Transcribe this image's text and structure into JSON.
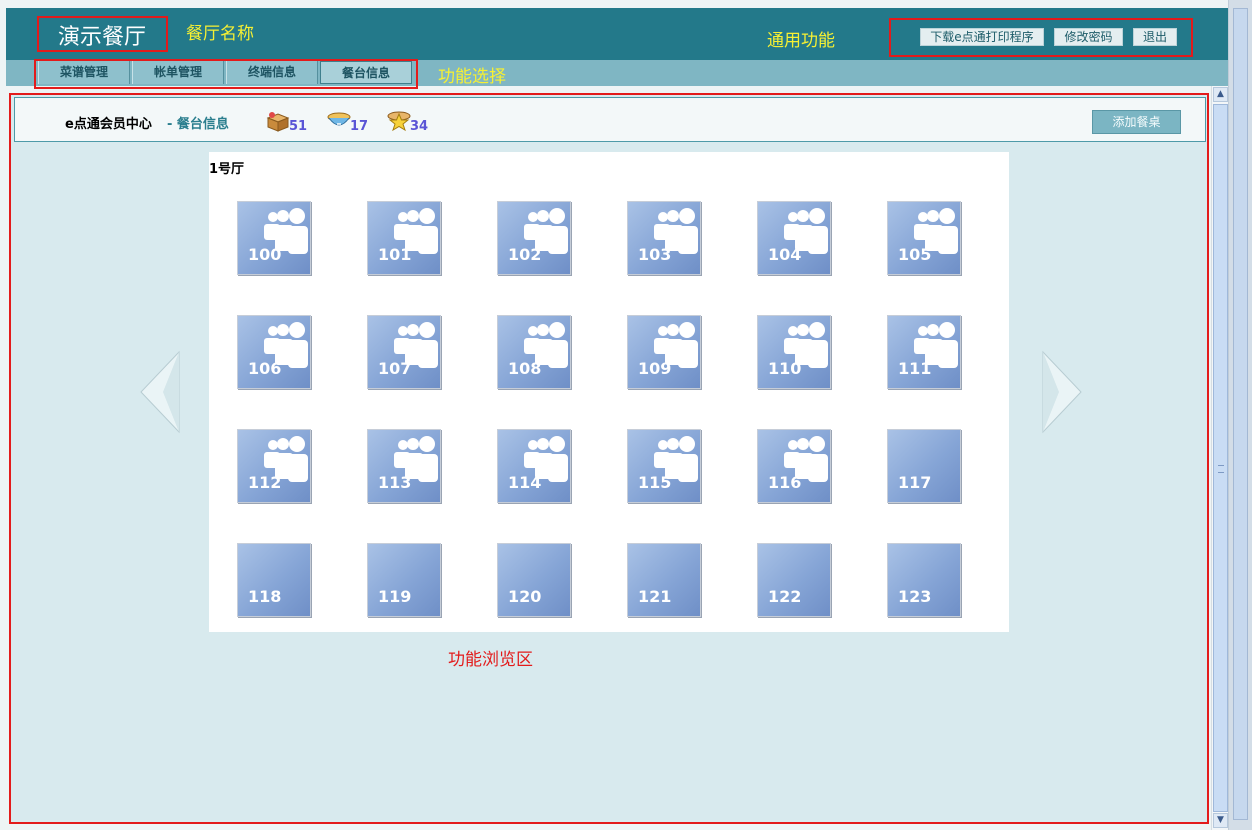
{
  "header": {
    "restaurant_name": "演示餐厅",
    "annotation_name": "餐厅名称",
    "annotation_common": "通用功能",
    "buttons": {
      "download": "下载e点通打印程序",
      "change_password": "修改密码",
      "logout": "退出"
    }
  },
  "menu": {
    "items": [
      {
        "label": "菜谱管理"
      },
      {
        "label": "帐单管理"
      },
      {
        "label": "终端信息"
      },
      {
        "label": "餐台信息"
      }
    ],
    "annotation": "功能选择"
  },
  "info_bar": {
    "member_center": "e点通会员中心",
    "separator": " - ",
    "page": "餐台信息",
    "stats": [
      {
        "icon": "box-icon",
        "count": "51"
      },
      {
        "icon": "bowl-icon",
        "count": "17"
      },
      {
        "icon": "star-icon",
        "count": "34"
      }
    ],
    "add_button": "添加餐桌"
  },
  "hall": {
    "name": "1号厅",
    "tables": [
      {
        "number": "100",
        "occupied": true
      },
      {
        "number": "101",
        "occupied": true
      },
      {
        "number": "102",
        "occupied": true
      },
      {
        "number": "103",
        "occupied": true
      },
      {
        "number": "104",
        "occupied": true
      },
      {
        "number": "105",
        "occupied": true
      },
      {
        "number": "106",
        "occupied": true
      },
      {
        "number": "107",
        "occupied": true
      },
      {
        "number": "108",
        "occupied": true
      },
      {
        "number": "109",
        "occupied": true
      },
      {
        "number": "110",
        "occupied": true
      },
      {
        "number": "111",
        "occupied": true
      },
      {
        "number": "112",
        "occupied": true
      },
      {
        "number": "113",
        "occupied": true
      },
      {
        "number": "114",
        "occupied": true
      },
      {
        "number": "115",
        "occupied": true
      },
      {
        "number": "116",
        "occupied": true
      },
      {
        "number": "117",
        "occupied": false
      },
      {
        "number": "118",
        "occupied": false
      },
      {
        "number": "119",
        "occupied": false
      },
      {
        "number": "120",
        "occupied": false
      },
      {
        "number": "121",
        "occupied": false
      },
      {
        "number": "122",
        "occupied": false
      },
      {
        "number": "123",
        "occupied": false
      }
    ]
  },
  "annotation_browse": "功能浏览区",
  "colors": {
    "header": "#23798a",
    "menubar": "#7fb6c3",
    "content": "#d8eaee",
    "annotation": "#f6f033",
    "highlight": "#e31b1b"
  }
}
